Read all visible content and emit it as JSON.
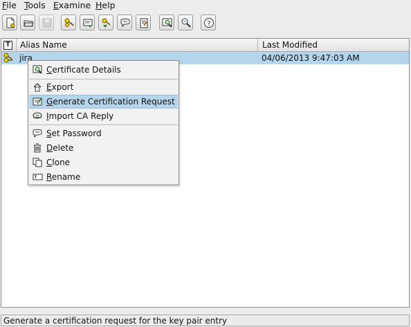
{
  "menubar": {
    "file": "File",
    "tools": "Tools",
    "examine": "Examine",
    "help": "Help"
  },
  "toolbar": {
    "buttons": [
      {
        "icon": "new-keystore-icon",
        "enabled": true
      },
      {
        "icon": "open-keystore-icon",
        "enabled": true
      },
      {
        "icon": "save-keystore-icon",
        "enabled": false
      },
      {
        "icon": "generate-key-pair-icon",
        "enabled": true
      },
      {
        "icon": "import-trusted-certificate-icon",
        "enabled": true
      },
      {
        "icon": "import-key-pair-icon",
        "enabled": true
      },
      {
        "icon": "set-password-icon",
        "enabled": true
      },
      {
        "icon": "keystore-report-icon",
        "enabled": true
      },
      {
        "icon": "examine-certificate-icon",
        "enabled": true
      },
      {
        "icon": "examine-ssl-icon",
        "enabled": true
      },
      {
        "icon": "help-icon",
        "enabled": true
      }
    ]
  },
  "table": {
    "type_header": "T",
    "columns": {
      "alias": "Alias Name",
      "modified": "Last Modified"
    },
    "rows": [
      {
        "alias": "jira",
        "modified": "04/06/2013 9:47:03 AM",
        "icon": "key-pair-icon",
        "selected": true
      }
    ]
  },
  "context_menu": {
    "items": [
      {
        "label": "Certificate Details",
        "icon": "certificate-details-icon"
      },
      {
        "label": "Export",
        "icon": "export-icon"
      },
      {
        "label": "Generate Certification Request",
        "icon": "generate-csr-icon",
        "highlighted": true
      },
      {
        "label": "Import CA Reply",
        "icon": "import-ca-reply-icon"
      },
      {
        "label": "Set Password",
        "icon": "set-password-icon"
      },
      {
        "label": "Delete",
        "icon": "delete-icon"
      },
      {
        "label": "Clone",
        "icon": "clone-icon"
      },
      {
        "label": "Rename",
        "icon": "rename-icon"
      }
    ]
  },
  "status_bar": {
    "text": "Generate a certification request for the key pair entry"
  },
  "colors": {
    "selection": "#b5d5ec",
    "menu_bg": "#f2f2f2",
    "window_bg": "#ececec"
  }
}
